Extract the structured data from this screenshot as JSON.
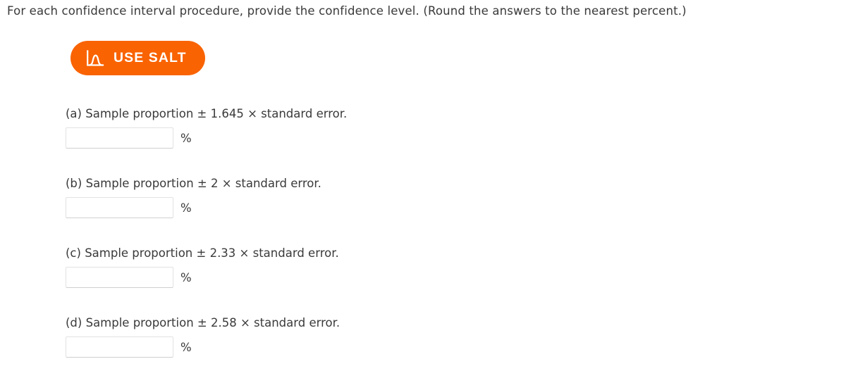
{
  "prompt": {
    "text": "For each confidence interval procedure, provide the confidence level. (Round the answers to the nearest percent.)"
  },
  "salt_button": {
    "label": "USE SALT",
    "icon": "normal-distribution-curve-icon",
    "background_color": "#f96302",
    "text_color": "#ffffff"
  },
  "questions": [
    {
      "id": "a",
      "text": "(a) Sample proportion ± 1.645 × standard error.",
      "input_value": "",
      "input_placeholder": "",
      "unit": "%"
    },
    {
      "id": "b",
      "text": "(b) Sample proportion ± 2 × standard error.",
      "input_value": "",
      "input_placeholder": "",
      "unit": "%"
    },
    {
      "id": "c",
      "text": "(c) Sample proportion ± 2.33 × standard error.",
      "input_value": "",
      "input_placeholder": "",
      "unit": "%"
    },
    {
      "id": "d",
      "text": "(d) Sample proportion ± 2.58 × standard error.",
      "input_value": "",
      "input_placeholder": "",
      "unit": "%"
    }
  ]
}
